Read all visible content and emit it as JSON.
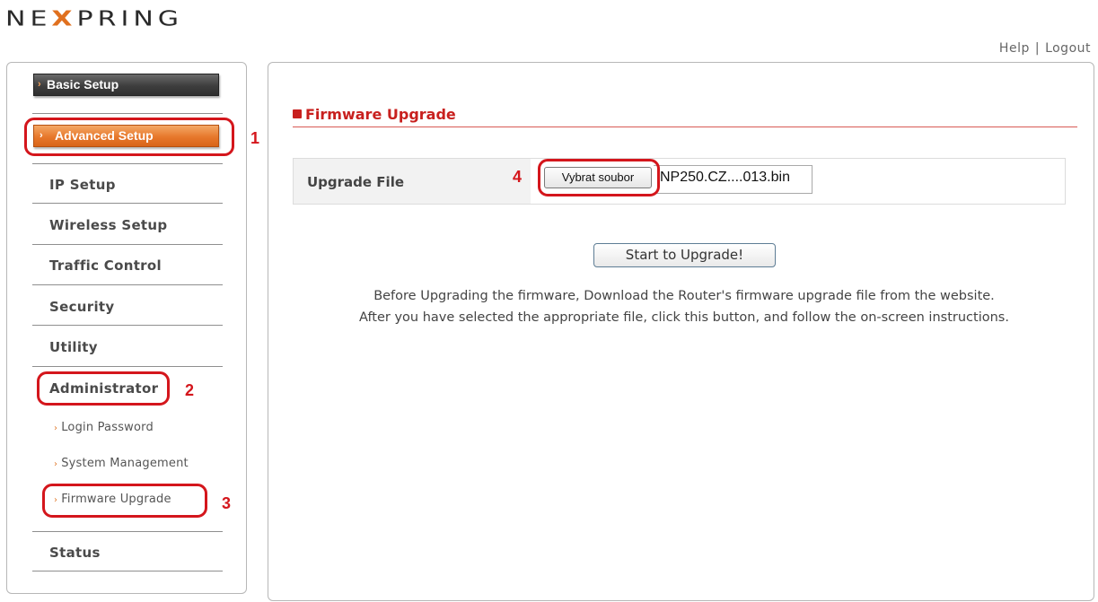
{
  "brand": {
    "logo_text": "NE",
    "logo_x": "X",
    "logo_rest": "PRING"
  },
  "toplinks": {
    "help": "Help",
    "separator": "|",
    "logout": "Logout"
  },
  "sidebar": {
    "basic_setup": "Basic Setup",
    "advanced_setup": "Advanced Setup",
    "items": [
      {
        "label": "IP Setup"
      },
      {
        "label": "Wireless Setup"
      },
      {
        "label": "Traffic Control"
      },
      {
        "label": "Security"
      },
      {
        "label": "Utility"
      },
      {
        "label": "Administrator"
      },
      {
        "label": "Status"
      }
    ],
    "sub_items": [
      {
        "label": "Login Password"
      },
      {
        "label": "System Management"
      },
      {
        "label": "Firmware Upgrade"
      }
    ]
  },
  "annotations": {
    "n1": "1",
    "n2": "2",
    "n3": "3",
    "n4": "4"
  },
  "main": {
    "title": "Firmware Upgrade",
    "upgrade_file_label": "Upgrade File",
    "choose_file_button": "Vybrat soubor",
    "file_name": "NP250.CZ....013.bin",
    "start_button": "Start to Upgrade!",
    "description_line1": "Before Upgrading the firmware, Download the Router's firmware upgrade file from the website.",
    "description_line2": "After you have selected the appropriate file, click this button, and follow the on-screen instructions."
  },
  "colors": {
    "accent_red": "#c8201e",
    "orange": "#e7782c",
    "annotation_red": "#d4161c"
  }
}
